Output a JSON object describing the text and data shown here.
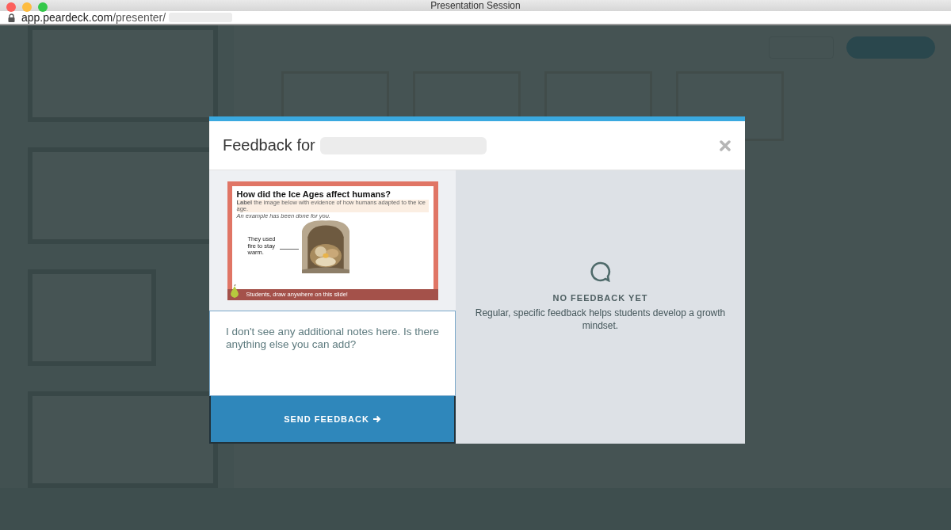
{
  "window": {
    "title": "Presentation Session"
  },
  "address_bar": {
    "host": "app.peardeck.com",
    "path": "/presenter/"
  },
  "modal": {
    "title": "Feedback for",
    "slide": {
      "title": "How did the Ice Ages affect humans?",
      "instruction": "**Label** the image below with evidence of how humans adapted to the ice age.",
      "note": "An example has been done for you.",
      "label": "They used fire to stay warm.",
      "footer": "Students, draw anywhere on this slide!"
    },
    "feedback": {
      "value": "I don't see any additional notes here. Is there anything else you can add?"
    },
    "send_button": "SEND FEEDBACK",
    "empty": {
      "heading": "NO FEEDBACK YET",
      "text": "Regular, specific feedback helps students develop a growth mindset."
    }
  }
}
